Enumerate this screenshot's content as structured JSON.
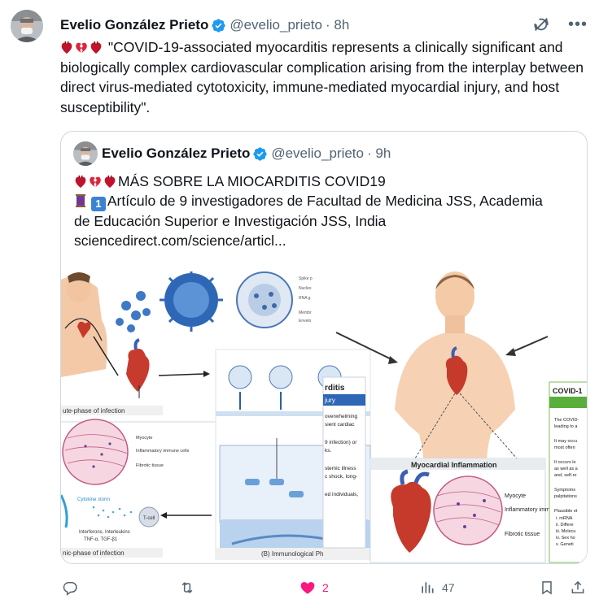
{
  "tweet": {
    "author_name": "Evelio González Prieto",
    "handle": "@evelio_prieto",
    "time": "· 8h",
    "text": "\"COVID-19-associated myocarditis represents a clinically significant and biologically complex cardiovascular complication arising from the interplay between direct virus-mediated cytotoxicity, immune-mediated myocardial injury, and host susceptibility\"."
  },
  "quoted": {
    "author_name": "Evelio González Prieto",
    "handle": "@evelio_prieto",
    "time": "· 9h",
    "line1": "MÁS SOBRE LA MIOCARDITIS COVID19",
    "line2": "Artículo de 9 investigadores de Facultad de Medicina JSS, Academia",
    "line3": "de Educación Superior e Investigación JSS, India",
    "line4": "sciencedirect.com/science/articl..."
  },
  "media": {
    "acute_phase": "ute-phase of infection",
    "chronic_phase": "nic-phase of infection",
    "myocarditis_cut": "rditis",
    "injury_cut": "jury",
    "immunological_panel": "(B) Immunological Ph",
    "myocardial_inflammation": "Myocardial Inflammation",
    "myocyte": "Myocyte",
    "inflammatory_cells": "Inflammatory immune cells",
    "fibrotic_tissue": "Fibrotic tissue",
    "small_myocyte": "Myocyte",
    "small_inflammatory": "Inflammatory immune cells",
    "small_fibrotic": "Fibrotic tissue",
    "cytokine_storm": "Cytokine storm",
    "tcell": "T-cell",
    "interferons": "Interferons, Interleukins",
    "tnf": "TNF-α, TGF-β1",
    "covid_box_title": "COVID-1",
    "text_overwhelming": "overwhelming",
    "text_sient": "sient  cardiac",
    "text_infection": "9 infection) or",
    "text_ks": "ks.",
    "text_systemic": "stemic illness",
    "text_shock": "c shock, long-",
    "text_individuals": "ed individuals,",
    "right_col_1": "The COVID-",
    "right_col_2": "leading to a",
    "right_col_3": "It may occu",
    "right_col_4": "most often",
    "right_col_5": "It occurs le",
    "right_col_6": "as well as a",
    "right_col_7": "and, self-re",
    "right_col_8": "Symptoms",
    "right_col_9": "palpitations",
    "right_col_10": "Plausible et",
    "right_col_11": "i.    mRNA",
    "right_col_12": "ii.   Differe",
    "right_col_13": "iii.  Molecu",
    "right_col_14": "iv.  Sex ho",
    "right_col_15": "v.   Geneti"
  },
  "actions": {
    "likes": "2",
    "views": "47"
  },
  "colors": {
    "like": "#f91880",
    "verified": "#1d9bf0",
    "muted": "#536471",
    "border": "#cfd9de"
  },
  "icons": [
    "verified-badge-icon",
    "grok-icon",
    "more-icon",
    "heart-emoji",
    "broken-heart-emoji",
    "thread-emoji",
    "keycap-one-emoji",
    "reply-icon",
    "retweet-icon",
    "like-icon",
    "views-icon",
    "bookmark-icon",
    "share-icon"
  ]
}
